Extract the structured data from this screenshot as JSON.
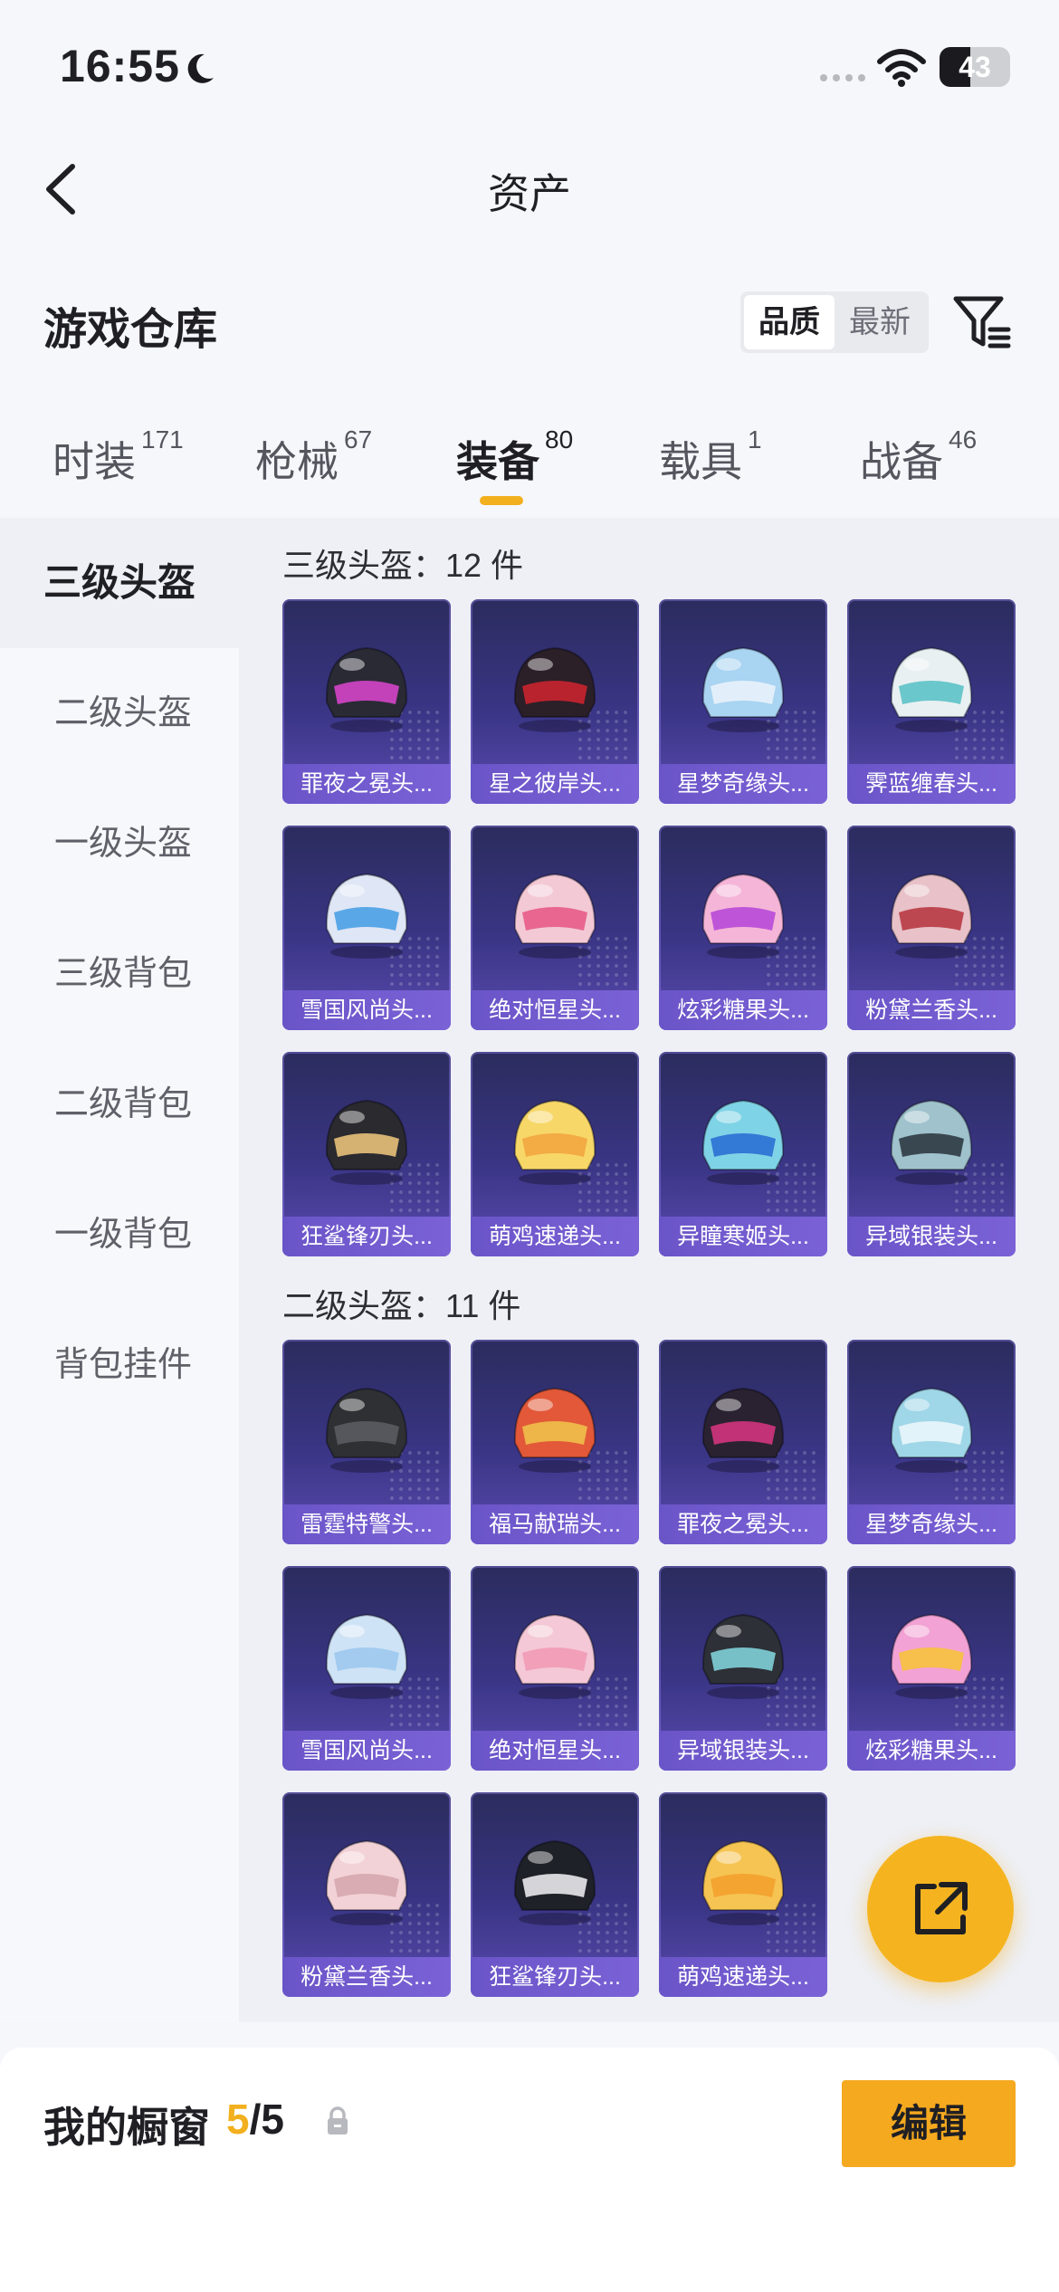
{
  "status_bar": {
    "time": "16:55",
    "battery": "43",
    "battery_level_pct": 43
  },
  "nav": {
    "title": "资产"
  },
  "warehouse": {
    "title": "游戏仓库",
    "sort_options": [
      "品质",
      "最新"
    ],
    "sort_selected": "品质"
  },
  "tabs": [
    {
      "label": "时装",
      "count": "171"
    },
    {
      "label": "枪械",
      "count": "67"
    },
    {
      "label": "装备",
      "count": "80",
      "active": true
    },
    {
      "label": "载具",
      "count": "1"
    },
    {
      "label": "战备",
      "count": "46"
    }
  ],
  "side_nav": [
    {
      "label": "三级头盔",
      "active": true
    },
    {
      "label": "二级头盔"
    },
    {
      "label": "一级头盔"
    },
    {
      "label": "三级背包"
    },
    {
      "label": "二级背包"
    },
    {
      "label": "一级背包"
    },
    {
      "label": "背包挂件"
    }
  ],
  "sections": [
    {
      "title": "三级头盔：12 件",
      "items": [
        {
          "label": "罪夜之冕头...",
          "color": "#2a2a35",
          "accent": "#d444c8"
        },
        {
          "label": "星之彼岸头...",
          "color": "#2b1f28",
          "accent": "#c9232d"
        },
        {
          "label": "星梦奇缘头...",
          "color": "#a9d4f2",
          "accent": "#e8f2fb"
        },
        {
          "label": "霁蓝缠春头...",
          "color": "#e9f0f2",
          "accent": "#5cc2c7"
        },
        {
          "label": "雪国风尚头...",
          "color": "#dfe6f5",
          "accent": "#4aa0e6"
        },
        {
          "label": "绝对恒星头...",
          "color": "#f3c9d6",
          "accent": "#e85b8a"
        },
        {
          "label": "炫彩糖果头...",
          "color": "#f5b5d8",
          "accent": "#b84ad8"
        },
        {
          "label": "粉黛兰香头...",
          "color": "#e8c2c8",
          "accent": "#b83a44"
        },
        {
          "label": "狂鲨锋刃头...",
          "color": "#2a2a2f",
          "accent": "#e8c07a"
        },
        {
          "label": "萌鸡速递头...",
          "color": "#f7d768",
          "accent": "#f2a640"
        },
        {
          "label": "异瞳寒姬头...",
          "color": "#7fd3e6",
          "accent": "#2b6fd4"
        },
        {
          "label": "异域银装头...",
          "color": "#9fc2cc",
          "accent": "#2e3a44"
        }
      ]
    },
    {
      "title": "二级头盔：11 件",
      "items": [
        {
          "label": "雷霆特警头...",
          "color": "#2f3033",
          "accent": "#5a5c60"
        },
        {
          "label": "福马献瑞头...",
          "color": "#e25838",
          "accent": "#f0c04a"
        },
        {
          "label": "罪夜之冕头...",
          "color": "#2a2230",
          "accent": "#d2357e"
        },
        {
          "label": "星梦奇缘头...",
          "color": "#9fd6e8",
          "accent": "#e9f6fb"
        },
        {
          "label": "雪国风尚头...",
          "color": "#cfe3f6",
          "accent": "#9cc8ee"
        },
        {
          "label": "绝对恒星头...",
          "color": "#f4c8d6",
          "accent": "#f29ab7"
        },
        {
          "label": "异域银装头...",
          "color": "#2d3036",
          "accent": "#7fd0d8"
        },
        {
          "label": "炫彩糖果头...",
          "color": "#f2a2d4",
          "accent": "#f7c23c"
        },
        {
          "label": "粉黛兰香头...",
          "color": "#f2d2d6",
          "accent": "#d6a6ae"
        },
        {
          "label": "狂鲨锋刃头...",
          "color": "#1f2128",
          "accent": "#e8e8ec"
        },
        {
          "label": "萌鸡速递头...",
          "color": "#f6c452",
          "accent": "#f3a12e"
        }
      ]
    }
  ],
  "bottom_bar": {
    "label": "我的橱窗",
    "count_current": "5",
    "count_sep_total": "/5",
    "edit_label": "编辑"
  },
  "colors": {
    "accent": "#f2b01e",
    "card_top": "#2b2c5e",
    "card_bottom": "#5a4bb0"
  }
}
